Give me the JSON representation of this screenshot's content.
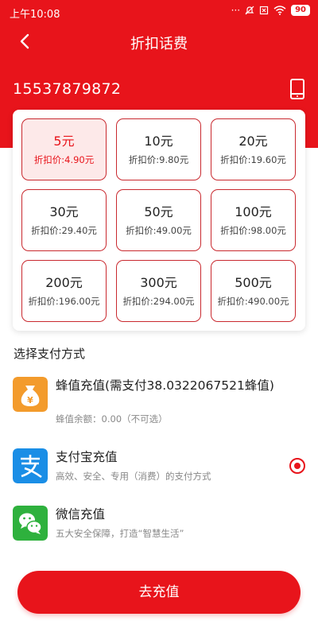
{
  "status_bar": {
    "time": "上午10:08",
    "battery": "90",
    "icons_text": "···"
  },
  "nav": {
    "title": "折扣话费"
  },
  "phone": {
    "number": "15537879872"
  },
  "denominations": [
    {
      "amount": "5元",
      "price": "折扣价:4.90元",
      "selected": true
    },
    {
      "amount": "10元",
      "price": "折扣价:9.80元"
    },
    {
      "amount": "20元",
      "price": "折扣价:19.60元"
    },
    {
      "amount": "30元",
      "price": "折扣价:29.40元"
    },
    {
      "amount": "50元",
      "price": "折扣价:49.00元"
    },
    {
      "amount": "100元",
      "price": "折扣价:98.00元"
    },
    {
      "amount": "200元",
      "price": "折扣价:196.00元"
    },
    {
      "amount": "300元",
      "price": "折扣价:294.00元"
    },
    {
      "amount": "500元",
      "price": "折扣价:490.00元"
    }
  ],
  "payment": {
    "title": "选择支付方式",
    "methods": [
      {
        "name": "蜂值充值(需支付38.0322067521蜂值)",
        "sub": "蜂值余额：0.00（不可选）",
        "icon": "money-bag-icon"
      },
      {
        "name": "支付宝充值",
        "sub": "高效、安全、专用（消费）的支付方式",
        "icon": "alipay-icon",
        "selected": true
      },
      {
        "name": "微信充值",
        "sub": "五大安全保障，打造“智慧生活”",
        "icon": "wechat-icon"
      }
    ]
  },
  "submit": {
    "label": "去充值"
  },
  "colors": {
    "primary": "#e8141b",
    "alipay": "#1a8ee6",
    "wechat": "#2eb13d",
    "bag": "#f39b2c"
  }
}
